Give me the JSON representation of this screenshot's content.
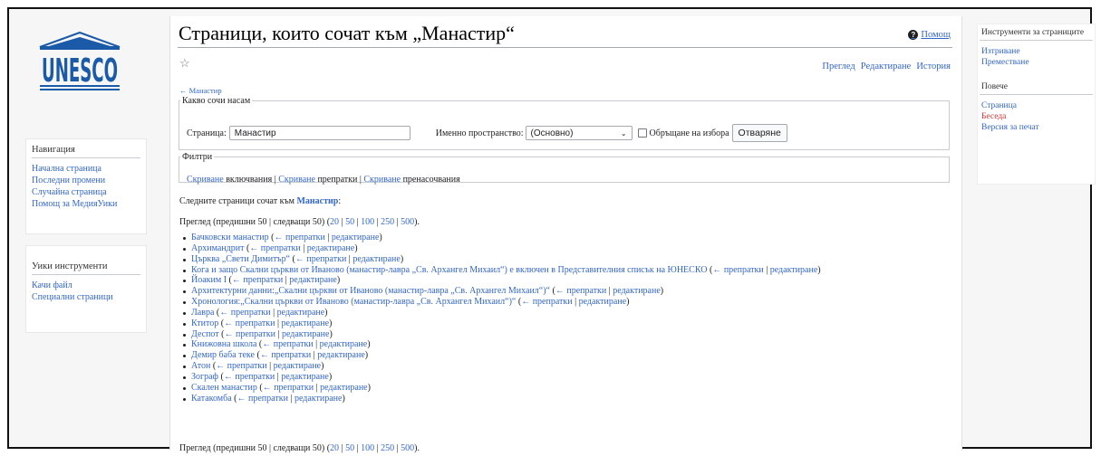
{
  "logo": {
    "text": "UNESCO"
  },
  "nav": {
    "heading": "Навигация",
    "items": [
      "Начална страница",
      "Последни промени",
      "Случайна страница",
      "Помощ за МедияУики"
    ]
  },
  "wiki_tools": {
    "heading": "Уики инструменти",
    "items": [
      "Качи файл",
      "Специални страници"
    ]
  },
  "page": {
    "title": "Страници, които сочат към „Манастир“",
    "help": "Помощ",
    "tabs": [
      "Преглед",
      "Редактиране",
      "История"
    ],
    "back_link": "← Манастир"
  },
  "form": {
    "legend": "Какво сочи насам",
    "page_label": "Страница:",
    "page_value": "Манастир",
    "namespace_label": "Именно пространство:",
    "namespace_value": "(Основно)",
    "invert_label": "Обръщане на избора",
    "submit": "Отваряне"
  },
  "filters": {
    "legend": "Филтри",
    "hide": "Скриване",
    "transclusions": "включвания",
    "links": "препратки",
    "redirects": "пренасочвания",
    "sep": "|"
  },
  "results": {
    "intro_prefix": "Следните страници сочат към",
    "intro_target": "Манастир",
    "intro_suffix": ":",
    "pager": {
      "prefix": "Преглед (предишни 50 | следващи 50) (",
      "nums": [
        "20",
        "50",
        "100",
        "250",
        "500"
      ],
      "suffix": ")."
    },
    "links_label": "← препратки",
    "edit_label": "редактиране",
    "items": [
      "Бачковски манастир",
      "Архимандрит",
      "Църква „Свети Димитър“",
      "Кога и защо Скални църкви от Иваново (манастир-лавра „Св. Архангел Михаил“) е включен в Представителния списък на ЮНЕСКО",
      "Йоаким I",
      "Архитектурни данни:„Скални църкви от Иваново (манастир-лавра „Св. Архангел Михаил“)“",
      "Хронология:„Скални църкви от Иваново (манастир-лавра „Св. Архангел Михаил“)“",
      "Лавра",
      "Ктитор",
      "Деспот",
      "Книжовна школа",
      "Демир баба теке",
      "Атон",
      "Зограф",
      "Скален манастир",
      "Катакомба"
    ]
  },
  "page_tools": {
    "heading": "Инструменти за страниците",
    "items": [
      "Изтриване",
      "Преместване"
    ],
    "more_heading": "Повече",
    "more_items": [
      "Страница",
      "Беседа",
      "Версия за печат"
    ]
  },
  "colors": {
    "link": "#3366cc",
    "new_link": "#dd3333",
    "logo": "#1b5aa8"
  }
}
